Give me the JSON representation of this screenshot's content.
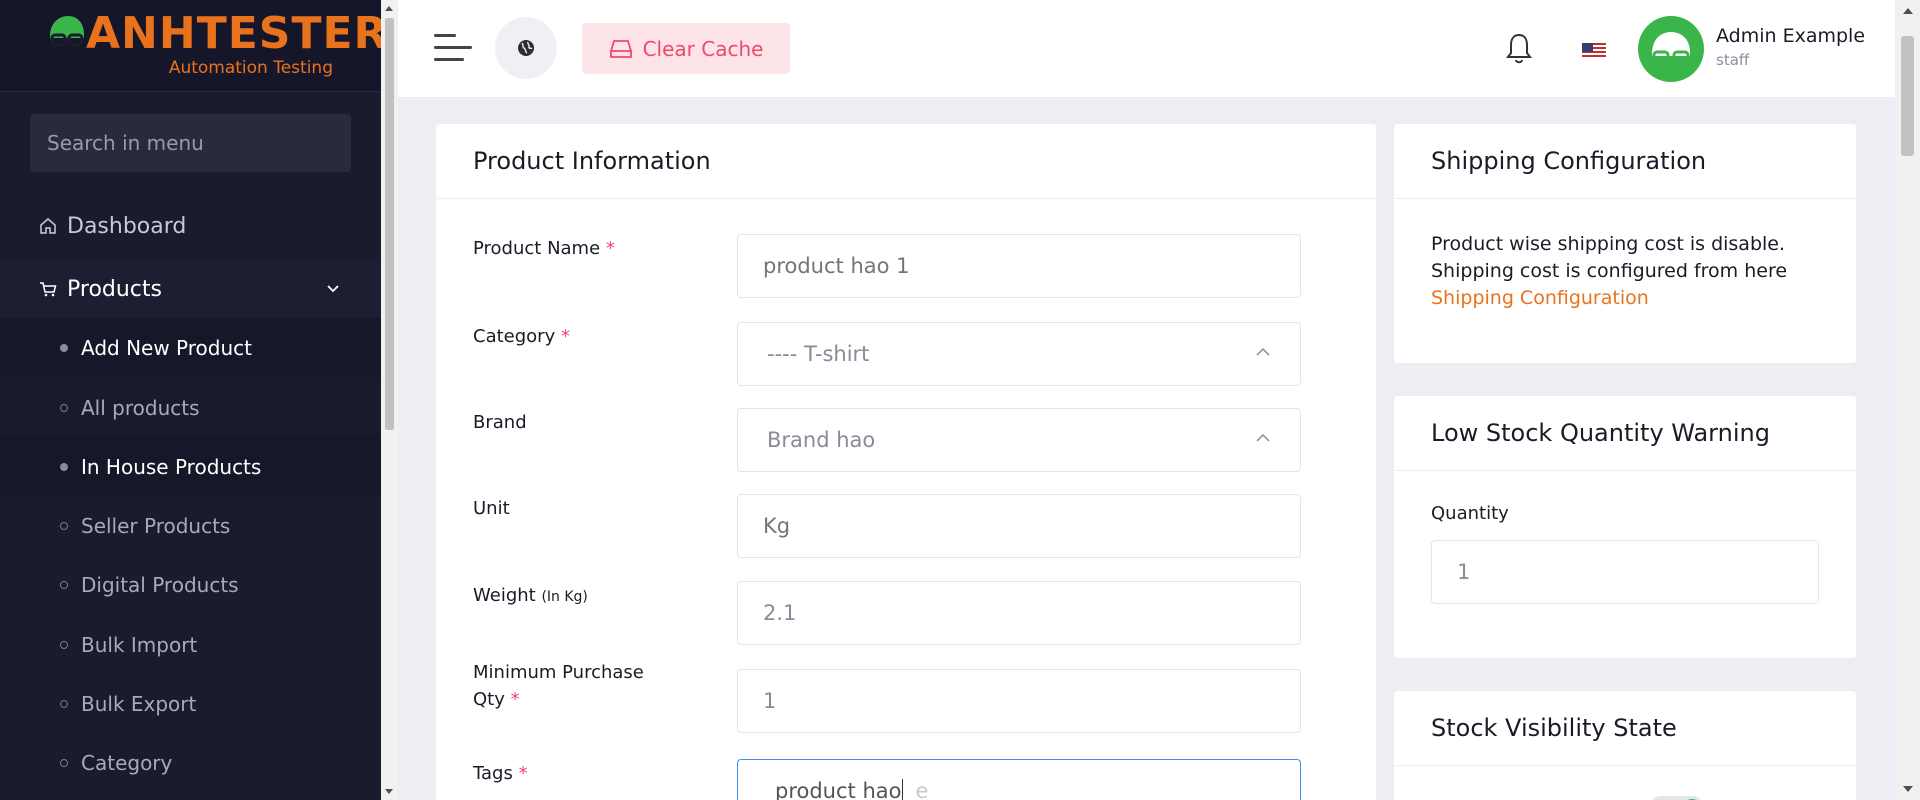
{
  "brand": {
    "name": "ANHTESTER",
    "tagline": "Automation Testing",
    "accent": "#e8731c"
  },
  "sidebar": {
    "search_placeholder": "Search in menu",
    "items": [
      {
        "label": "Dashboard",
        "icon": "home-icon"
      },
      {
        "label": "Products",
        "icon": "cart-icon",
        "expanded": true
      }
    ],
    "sub_items": [
      {
        "label": "Add New Product",
        "filled": true,
        "bright": true
      },
      {
        "label": "All products",
        "filled": false,
        "bright": false
      },
      {
        "label": "In House Products",
        "filled": true,
        "bright": true
      },
      {
        "label": "Seller Products",
        "filled": false,
        "bright": false
      },
      {
        "label": "Digital Products",
        "filled": false,
        "bright": false
      },
      {
        "label": "Bulk Import",
        "filled": false,
        "bright": false
      },
      {
        "label": "Bulk Export",
        "filled": false,
        "bright": false
      },
      {
        "label": "Category",
        "filled": false,
        "bright": false
      }
    ]
  },
  "topbar": {
    "clear_cache_label": "Clear Cache",
    "user_name": "Admin Example",
    "user_role": "staff"
  },
  "product_info": {
    "title": "Product Information",
    "fields": {
      "product_name": {
        "label": "Product Name",
        "required": "*",
        "placeholder": "product hao 1"
      },
      "category": {
        "label": "Category",
        "required": "*",
        "value": "---- T-shirt"
      },
      "brand": {
        "label": "Brand",
        "value": "Brand hao"
      },
      "unit": {
        "label": "Unit",
        "placeholder": "Kg"
      },
      "weight": {
        "label": "Weight",
        "unit_note": "(In Kg)",
        "value": "2.1"
      },
      "min_qty": {
        "label_line1": "Minimum Purchase",
        "label_line2": "Qty",
        "required": "*",
        "value": "1"
      },
      "tags": {
        "label": "Tags",
        "required": "*",
        "value": "product hao",
        "placeholder_tail": "e"
      }
    }
  },
  "shipping": {
    "title": "Shipping Configuration",
    "text_line1": "Product wise shipping cost is disable.",
    "text_line2": "Shipping cost is configured from here",
    "link": "Shipping Configuration"
  },
  "low_stock": {
    "title": "Low Stock Quantity Warning",
    "quantity_label": "Quantity",
    "quantity_value": "1"
  },
  "stock_visibility": {
    "title": "Stock Visibility State"
  }
}
